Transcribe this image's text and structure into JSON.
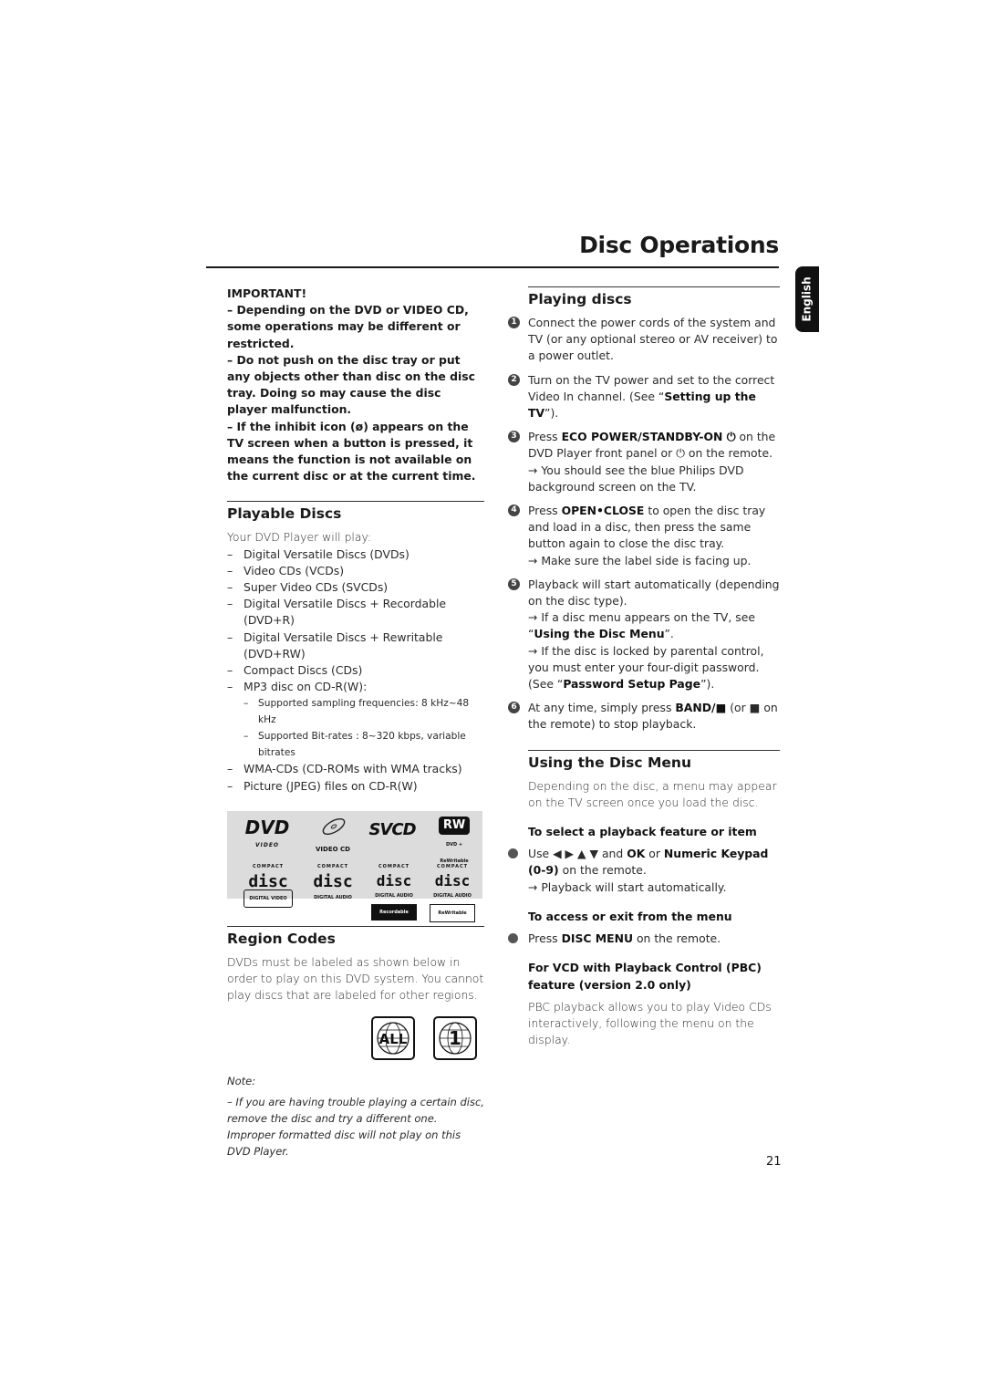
{
  "header": {
    "title": "Disc Operations",
    "language_tab": "English"
  },
  "important": {
    "title": "IMPORTANT!",
    "items": [
      "–  Depending on the DVD or VIDEO CD, some operations may be different or restricted.",
      "–  Do not push on the disc tray or put any objects other than disc on the disc tray. Doing so may cause the disc player malfunction.",
      "–  If the inhibit icon (ø) appears on the TV screen when a button is pressed, it means the function is not available on the current disc or at the current time."
    ]
  },
  "playable_discs": {
    "title": "Playable Discs",
    "intro": "Your DVD Player will play:",
    "items": [
      "Digital Versatile Discs (DVDs)",
      "Video CDs (VCDs)",
      "Super Video CDs (SVCDs)",
      "Digital Versatile Discs + Recordable (DVD+R)",
      "Digital Versatile Discs + Rewritable (DVD+RW)",
      "Compact Discs (CDs)",
      "MP3 disc on CD-R(W):"
    ],
    "sub_items": [
      "Supported sampling frequencies: 8 kHz~48 kHz",
      "Supported Bit-rates : 8~320 kbps, variable bitrates"
    ],
    "items_after": [
      "WMA-CDs (CD-ROMs with  WMA tracks)",
      "Picture (JPEG) files on CD-R(W)"
    ],
    "logos": {
      "dvd": "DVD",
      "dvd_sub": "VIDEO",
      "vcd": "VIDEO CD",
      "svcd": "SVCD",
      "rw": "RW",
      "rw_sub": "DVD + ReWritable",
      "cd_top": "COMPACT",
      "cd_word": "disc",
      "cd1_sub": "DIGITAL VIDEO",
      "cd2_sub": "DIGITAL AUDIO",
      "cd3_sub": "DIGITAL AUDIO",
      "cd3_sub2": "Recordable",
      "cd4_sub": "DIGITAL AUDIO",
      "cd4_sub2": "ReWritable"
    }
  },
  "region_codes": {
    "title": "Region Codes",
    "text": "DVDs must be labeled as shown below in order to play on this DVD system. You cannot play discs that are labeled for other regions.",
    "badges": [
      "ALL",
      "1"
    ],
    "note_label": "Note:",
    "note_text": "–  If you are having trouble playing a certain disc, remove the disc and try a different one. Improper formatted disc will not play on this DVD Player."
  },
  "playing_discs": {
    "title": "Playing discs",
    "steps": [
      {
        "num": "1",
        "pre": "Connect the power cords of the system and TV (or any optional stereo or AV receiver) to a power outlet.",
        "bold": "",
        "post": "",
        "arrows": []
      },
      {
        "num": "2",
        "pre": "Turn on the TV power and set to the correct Video In channel. (See “",
        "bold": "Setting up the TV",
        "post": "”).",
        "arrows": []
      },
      {
        "num": "3",
        "pre": "Press ",
        "bold": "ECO POWER/STANDBY-ON ⏻",
        "post": " on the DVD Player front panel or ⏻ on the remote.",
        "arrows": [
          "→ You should see the blue Philips DVD background screen on the TV."
        ]
      },
      {
        "num": "4",
        "pre": "Press ",
        "bold": "OPEN•CLOSE",
        "post": " to open the disc tray and load in a disc, then press the same button again to close the disc tray.",
        "arrows": [
          "→ Make sure the label side is facing up."
        ]
      },
      {
        "num": "5",
        "pre": "Playback will start automatically (depending on the disc type).",
        "bold": "",
        "post": "",
        "arrows": []
      },
      {
        "num": "6",
        "pre": "At any time, simply press ",
        "bold": "BAND/■",
        "post": " (or ■  on the remote) to stop playback.",
        "arrows": []
      }
    ],
    "step5_arrow1_pre": "→ If a disc menu appears on the TV, see “",
    "step5_arrow1_bold": "Using the Disc Menu",
    "step5_arrow1_post": "”.",
    "step5_arrow2_pre": "→ If the disc is locked by parental control, you must enter your four-digit password. (See “",
    "step5_arrow2_bold": "Password Setup Page",
    "step5_arrow2_post": "”)."
  },
  "disc_menu": {
    "title": "Using the Disc Menu",
    "intro": "Depending on the disc, a menu may appear on the TV screen once you load the disc.",
    "select_head": "To select a playback feature or item",
    "select_pre": "Use ◀ ▶ ▲ ▼  and ",
    "select_ok": "OK",
    "select_or": " or ",
    "select_keypad": "Numeric Keypad (0-9)",
    "select_post": " on the remote.",
    "select_arrow": "→ Playback will start automatically.",
    "access_head": "To access or exit from the menu",
    "access_pre": "Press ",
    "access_bold": "DISC MENU",
    "access_post": " on the remote.",
    "pbc_head": "For VCD with Playback Control (PBC) feature (version 2.0 only)",
    "pbc_text": "PBC playback allows you to play Video CDs interactively, following the menu on the display."
  },
  "footer": {
    "page_number": "21"
  }
}
